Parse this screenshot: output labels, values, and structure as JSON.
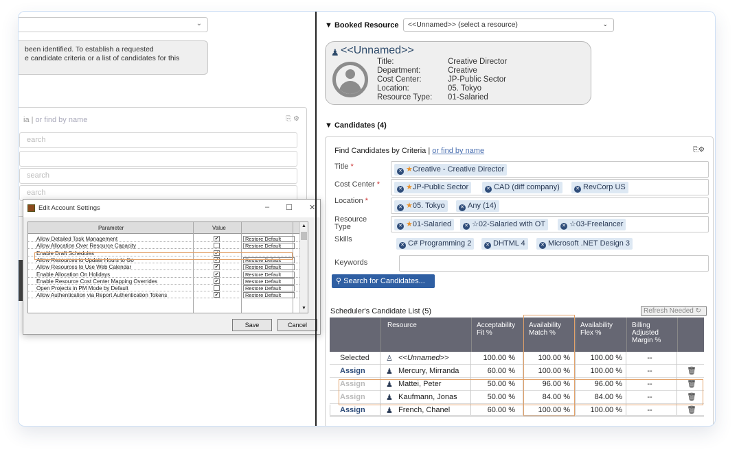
{
  "left": {
    "message_line1": "been identified. To establish a requested",
    "message_line2": "e candidate criteria or a list of candidates for this",
    "criteria_text": "ia |",
    "criteria_link": "or find by name",
    "search_placeholder": "earch",
    "search_placeholder2": "search",
    "search_placeholder3": "earch"
  },
  "dialog": {
    "title": "Edit Account Settings",
    "col_param": "Parameter",
    "col_value": "Value",
    "rows": [
      {
        "param": "Allow Detailed Task Management",
        "value": "✔",
        "restore": "Restore Default"
      },
      {
        "param": "Allow Allocation Over Resource Capacity",
        "value": "",
        "restore": "Restore Default"
      },
      {
        "param": "Enable Draft Schedules",
        "value": "✔",
        "restore": ""
      },
      {
        "param": "Allow Resources to Update Hours to Go",
        "value": "✔",
        "restore": "Restore Default"
      },
      {
        "param": "Allow Resources to Use Web Calendar",
        "value": "✔",
        "restore": "Restore Default"
      },
      {
        "param": "Enable Allocation On Holidays",
        "value": "✔",
        "restore": "Restore Default"
      },
      {
        "param": "Enable Resource Cost Center Mapping Overrides",
        "value": "✔",
        "restore": "Restore Default"
      },
      {
        "param": "Open Projects in PM Mode by Default",
        "value": "",
        "restore": "Restore Default"
      },
      {
        "param": "Allow Authentication via Report Authentication Tokens",
        "value": "✔",
        "restore": "Restore Default"
      }
    ],
    "save": "Save",
    "cancel": "Cancel"
  },
  "booked": {
    "label": "▼ Booked Resource",
    "select_value": "<<Unnamed>> (select a resource)",
    "name": "<<Unnamed>>",
    "fields": [
      {
        "k": "Title:",
        "v": "Creative Director"
      },
      {
        "k": "Department:",
        "v": "Creative"
      },
      {
        "k": "Cost Center:",
        "v": "JP-Public Sector"
      },
      {
        "k": "Location:",
        "v": "05. Tokyo"
      },
      {
        "k": "Resource Type:",
        "v": "01-Salaried"
      }
    ]
  },
  "candidates": {
    "label": "▼ Candidates (4)",
    "find_label": "Find Candidates by Criteria |",
    "find_link": "or find by name",
    "title_label": "Title",
    "title_tag": "Creative - Creative Director",
    "cost_label": "Cost Center",
    "cost_tags": [
      "JP-Public Sector",
      "CAD (diff company)",
      "RevCorp US"
    ],
    "loc_label": "Location",
    "loc_tags": [
      "05. Tokyo",
      "Any (14)"
    ],
    "rtype_label1": "Resource",
    "rtype_label2": "Type",
    "rtype_tags": [
      "01-Salaried",
      "02-Salaried with OT",
      "03-Freelancer"
    ],
    "skills_label": "Skills",
    "skill_tags": [
      "C# Programming 2",
      "DHTML 4",
      "Microsoft .NET Design 3"
    ],
    "keywords_label": "Keywords",
    "search_button": "Search for Candidates...",
    "list_title": "Scheduler's Candidate List (5)",
    "refresh": "Refresh Needed ↻",
    "headers": {
      "resource": "Resource",
      "fit": "Acceptability Fit %",
      "match": "Availability Match %",
      "flex": "Availability Flex %",
      "margin": "Billing Adjusted Margin %"
    },
    "rows": [
      {
        "action": "Selected",
        "name": "<<Unnamed>>",
        "fit": "100.00 %",
        "match": "100.00 %",
        "flex": "100.00 %",
        "margin": "--"
      },
      {
        "action": "Assign",
        "name": "Mercury, Mirranda",
        "fit": "60.00 %",
        "match": "100.00 %",
        "flex": "100.00 %",
        "margin": "--"
      },
      {
        "action": "Assign",
        "name": "Mattei, Peter",
        "fit": "50.00 %",
        "match": "96.00 %",
        "flex": "96.00 %",
        "margin": "--"
      },
      {
        "action": "Assign",
        "name": "Kaufmann, Jonas",
        "fit": "50.00 %",
        "match": "84.00 %",
        "flex": "84.00 %",
        "margin": "--"
      },
      {
        "action": "Assign",
        "name": "French, Chanel",
        "fit": "60.00 %",
        "match": "100.00 %",
        "flex": "100.00 %",
        "margin": "--"
      }
    ]
  }
}
